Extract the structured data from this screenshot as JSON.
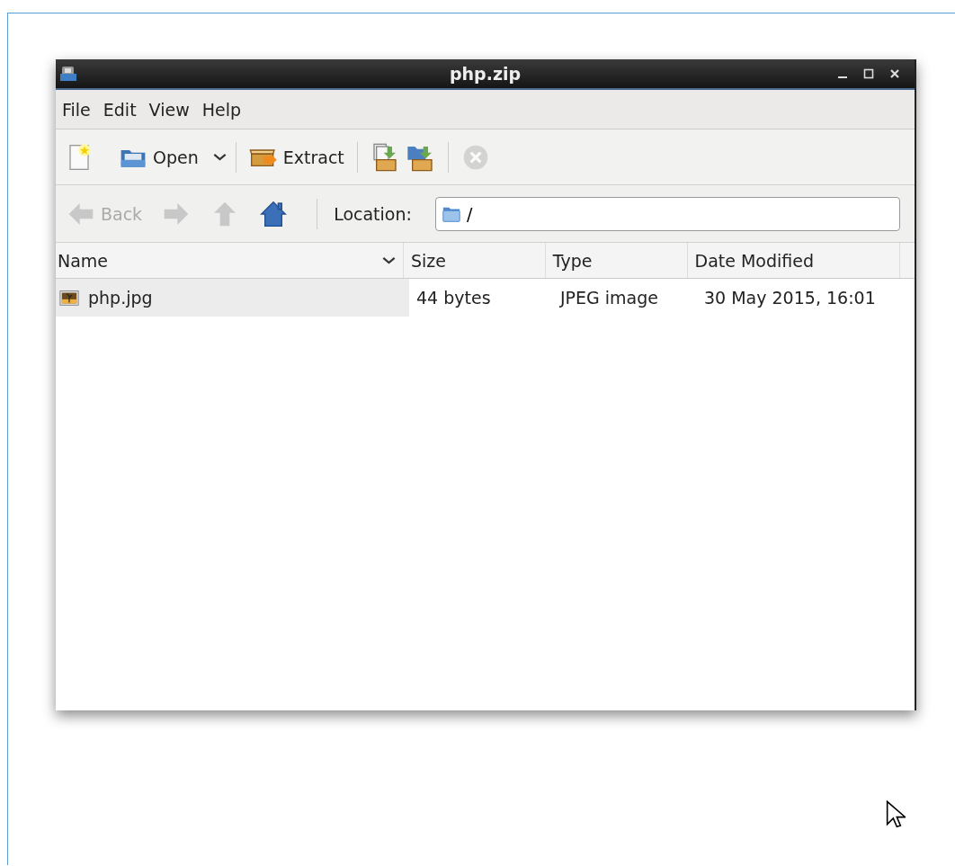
{
  "window": {
    "title": "php.zip"
  },
  "menu": [
    {
      "label": "File"
    },
    {
      "label": "Edit"
    },
    {
      "label": "View"
    },
    {
      "label": "Help"
    }
  ],
  "toolbar": [
    {
      "kind": "new",
      "disabled": false
    },
    {
      "kind": "separator-none"
    },
    {
      "kind": "open",
      "label": "Open",
      "disabled": false
    },
    {
      "kind": "separator"
    },
    {
      "kind": "extract",
      "label": "Extract",
      "disabled": false
    },
    {
      "kind": "separator"
    },
    {
      "kind": "add-files",
      "disabled": false
    },
    {
      "kind": "add-folder",
      "disabled": false
    },
    {
      "kind": "separator"
    },
    {
      "kind": "stop",
      "disabled": true
    }
  ],
  "navigation": [
    {
      "kind": "back",
      "label": "Back",
      "disabled": true
    },
    {
      "kind": "forward",
      "disabled": true
    },
    {
      "kind": "up",
      "disabled": true
    },
    {
      "kind": "home",
      "disabled": false
    }
  ],
  "location": {
    "label": "Location:",
    "value": "/"
  },
  "table": {
    "columns": [
      {
        "label": "Name",
        "sorted": true
      },
      {
        "label": "Size",
        "sorted": false
      },
      {
        "label": "Type",
        "sorted": false
      },
      {
        "label": "Date Modified",
        "sorted": false
      }
    ],
    "rows": [
      {
        "cells": [
          "php.jpg",
          "44 bytes",
          "JPEG image",
          "30 May 2015, 16:01"
        ]
      }
    ]
  }
}
